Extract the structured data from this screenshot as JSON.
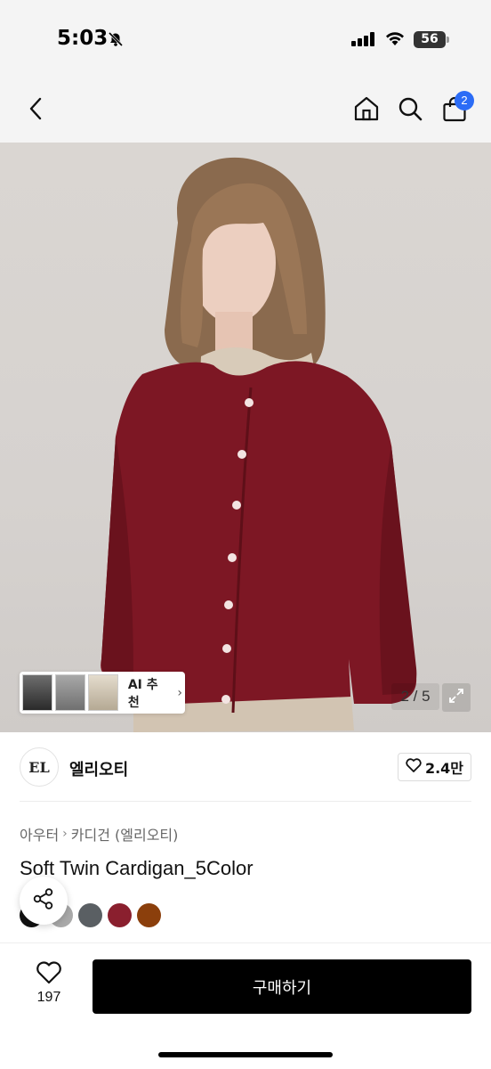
{
  "status": {
    "time": "5:03",
    "battery": "56"
  },
  "nav": {
    "cart_count": "2"
  },
  "hero": {
    "counter": "2 / 5",
    "ai_label": "AI 추천"
  },
  "brand": {
    "logo_text": "EL",
    "name": "엘리오티",
    "likes": "2.4만"
  },
  "breadcrumb": {
    "parent": "아우터",
    "child": "카디건 (엘리오티)"
  },
  "product": {
    "title": "Soft Twin Cardigan_5Color"
  },
  "colors": [
    "#111111",
    "#a9a9a9",
    "#5a5f63",
    "#8a1f2e",
    "#8b3f0c"
  ],
  "bottom": {
    "wish_count": "197",
    "buy_label": "구매하기"
  }
}
